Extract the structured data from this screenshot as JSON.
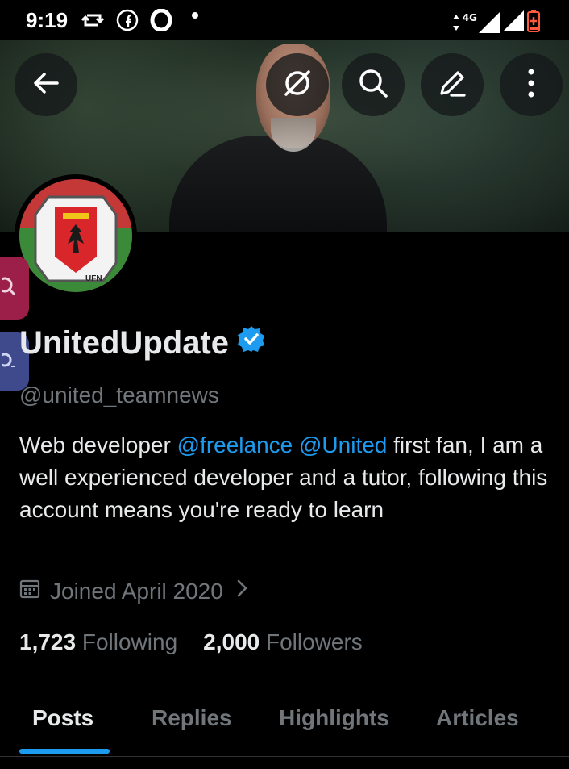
{
  "status_bar": {
    "time": "9:19",
    "network": "4G",
    "icons": [
      "sync-icon",
      "facebook-icon",
      "opera-icon",
      "dot-icon",
      "signal-icon",
      "wifi-icon",
      "battery-icon"
    ]
  },
  "header": {
    "buttons": [
      "back-icon",
      "hide-icon",
      "search-icon",
      "edit-icon",
      "more-icon"
    ]
  },
  "profile": {
    "display_name": "UnitedUpdate",
    "verified": true,
    "handle": "@united_teamnews",
    "bio": {
      "part1": "Web developer ",
      "mention1": "@freelance",
      "space": " ",
      "mention2": "@United",
      "part2": " first fan, I am a well experienced developer and a tutor, following this account means you're ready to learn"
    },
    "joined": "Joined April 2020",
    "following_count": "1,723",
    "following_label": "Following",
    "followers_count": "2,000",
    "followers_label": "Followers",
    "avatar_badge_text": "UFN"
  },
  "tabs": [
    {
      "label": "Posts",
      "active": true
    },
    {
      "label": "Replies",
      "active": false
    },
    {
      "label": "Highlights",
      "active": false
    },
    {
      "label": "Articles",
      "active": false
    }
  ],
  "colors": {
    "accent": "#1d9bf0",
    "muted": "#71767b",
    "text": "#e7e9ea",
    "background": "#000000"
  }
}
